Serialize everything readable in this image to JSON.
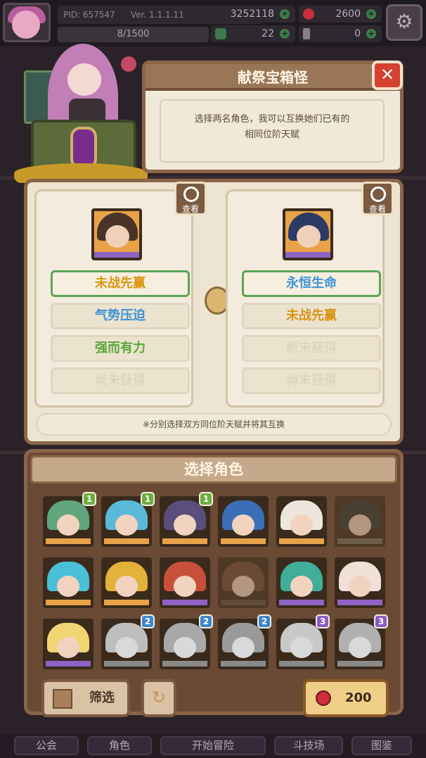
{
  "topbar": {
    "pid": "PID: 657547",
    "version": "Ver. 1.1.1.11",
    "xp": "8/1500",
    "gold": "3252118",
    "gems": "2600",
    "clover": "22",
    "keys": "0"
  },
  "dialog": {
    "title": "献祭宝箱怪",
    "message_line1": "选择两名角色，我可以互换她们已有的",
    "message_line2": "相同位阶天赋"
  },
  "swap": {
    "view_label": "查看",
    "left": {
      "talents": [
        {
          "label": "未战先赢",
          "style": "gold",
          "selected": true
        },
        {
          "label": "气势压迫",
          "style": "blue",
          "selected": false
        },
        {
          "label": "强而有力",
          "style": "green",
          "selected": false
        },
        {
          "label": "尚未获得",
          "style": "locked",
          "selected": false
        }
      ]
    },
    "right": {
      "talents": [
        {
          "label": "永恒生命",
          "style": "blue",
          "selected": true
        },
        {
          "label": "未战先赢",
          "style": "gold",
          "selected": false
        },
        {
          "label": "尚未获得",
          "style": "locked",
          "selected": false
        },
        {
          "label": "尚未获得",
          "style": "locked",
          "selected": false
        }
      ]
    },
    "note": "※分别选择双方同位阶天赋并将其互换"
  },
  "roster": {
    "title": "选择角色",
    "characters": [
      {
        "hair": "#5fa67c",
        "bar": "#e8a348",
        "badge": "1",
        "badge_color": "g"
      },
      {
        "hair": "#5ab8d8",
        "bar": "#e8a348",
        "badge": "1",
        "badge_color": "g"
      },
      {
        "hair": "#5a4e7c",
        "bar": "#e8a348",
        "badge": "1",
        "badge_color": "g"
      },
      {
        "hair": "#3a6fb8",
        "bar": "#e8a348",
        "badge": "",
        "badge_color": ""
      },
      {
        "hair": "#ece6dc",
        "bar": "#e8a348",
        "badge": "",
        "badge_color": ""
      },
      {
        "hair": "#2e3a30",
        "bar": "#6e6e5a",
        "badge": "",
        "badge_color": "",
        "dim": true
      },
      {
        "hair": "#4ac0d8",
        "bar": "#e8a348",
        "badge": "",
        "badge_color": ""
      },
      {
        "hair": "#e2b23a",
        "bar": "#e8a348",
        "badge": "",
        "badge_color": ""
      },
      {
        "hair": "#c8503a",
        "bar": "#8f62c6",
        "badge": "",
        "badge_color": ""
      },
      {
        "hair": "#6a4a34",
        "bar": "#5a4a3c",
        "badge": "",
        "badge_color": "",
        "dim": true
      },
      {
        "hair": "#3fae9a",
        "bar": "#8f62c6",
        "badge": "",
        "badge_color": ""
      },
      {
        "hair": "#f0e0d8",
        "bar": "#8f62c6",
        "badge": "",
        "badge_color": ""
      },
      {
        "hair": "#f1d572",
        "bar": "#8f62c6",
        "badge": "",
        "badge_color": ""
      },
      {
        "hair": "#bdbdbd",
        "bar": "#8a8a8a",
        "badge": "2",
        "badge_color": "b",
        "gray": true
      },
      {
        "hair": "#a8a8a8",
        "bar": "#8a8a8a",
        "badge": "2",
        "badge_color": "b",
        "gray": true
      },
      {
        "hair": "#9a9a9a",
        "bar": "#8a8a8a",
        "badge": "2",
        "badge_color": "b",
        "gray": true
      },
      {
        "hair": "#c8c8c8",
        "bar": "#8a8a8a",
        "badge": "3",
        "badge_color": "p",
        "gray": true
      },
      {
        "hair": "#b0b0b0",
        "bar": "#8a8a8a",
        "badge": "3",
        "badge_color": "p",
        "gray": true
      }
    ],
    "filter_label": "筛选",
    "cost": "200"
  },
  "nav": [
    "公会",
    "角色",
    "开始冒险",
    "斗技场",
    "图鉴"
  ],
  "colors": {
    "accent_gold": "#d99514",
    "accent_blue": "#3c93d6",
    "accent_green": "#5aa63a",
    "frame_brown": "#8a6548",
    "close_red": "#d6402f"
  }
}
